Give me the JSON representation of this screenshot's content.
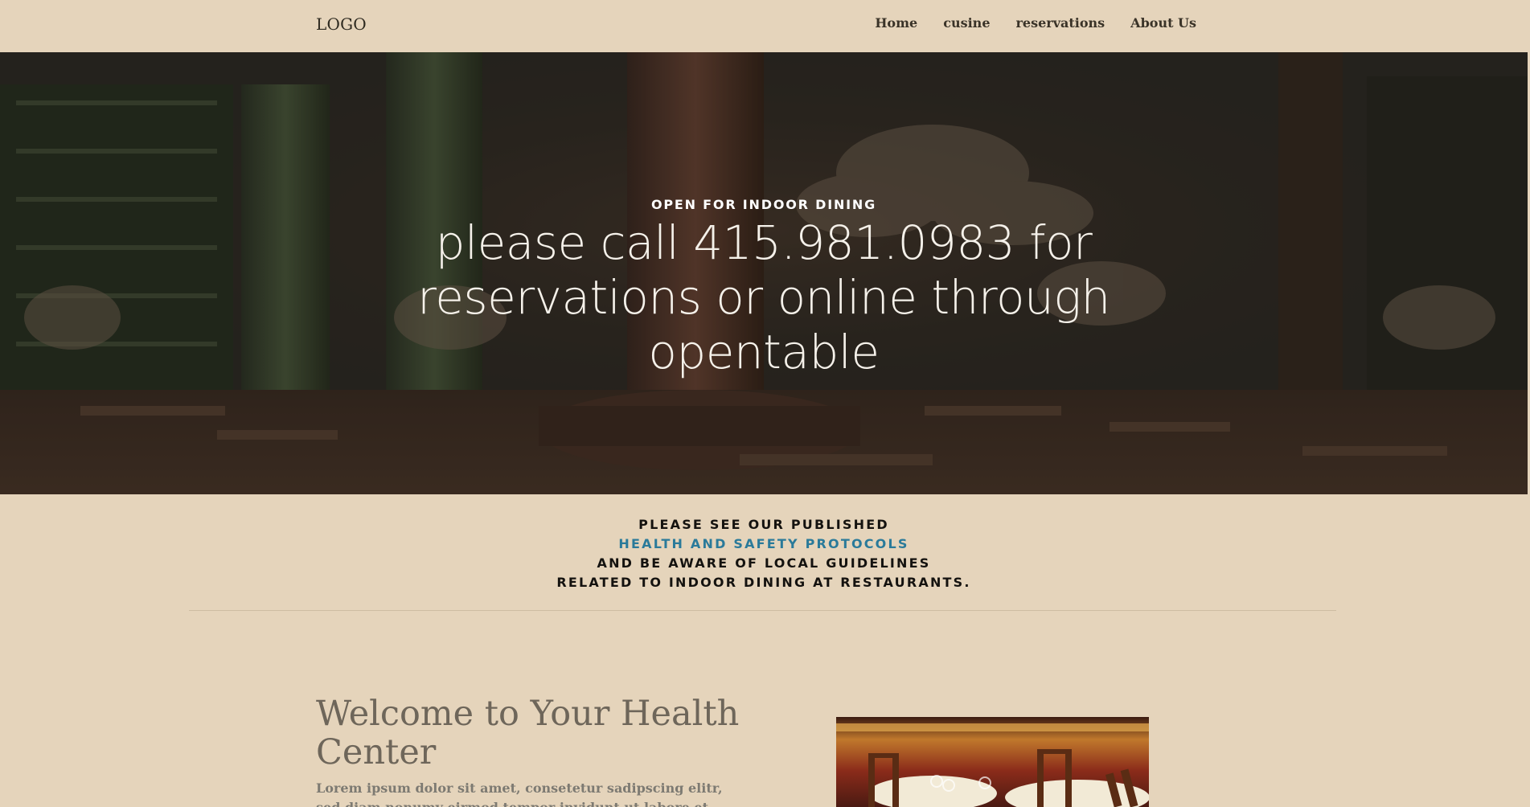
{
  "nav": {
    "logo": "LOGO",
    "links": [
      "Home",
      "cusine",
      "reservations",
      "About Us"
    ]
  },
  "hero": {
    "kicker": "OPEN FOR INDOOR DINING",
    "heading": "please call 415.981.0983 for reservations or online through opentable"
  },
  "notice": {
    "line1": "PLEASE SEE OUR PUBLISHED",
    "link": "HEALTH AND SAFETY PROTOCOLS",
    "line3": "AND BE AWARE OF LOCAL GUIDELINES",
    "line4": "RELATED TO INDOOR DINING AT RESTAURANTS."
  },
  "welcome": {
    "title": "Welcome to Your Health Center",
    "text": "Lorem ipsum dolor sit amet, consetetur sadipscing elitr, sed diam nonumy eirmod tempor invidunt ut labore et dolore magna aliquyam"
  },
  "colors": {
    "background": "#e5d4bb",
    "link": "#2a7a9a",
    "text_dark": "#14120f"
  }
}
